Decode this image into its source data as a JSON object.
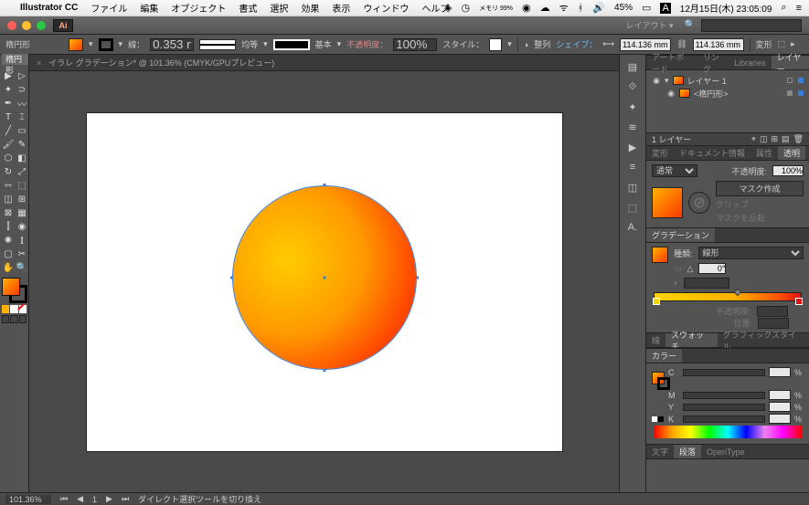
{
  "menubar": {
    "app": "Illustrator CC",
    "items": [
      "ファイル",
      "編集",
      "オブジェクト",
      "書式",
      "選択",
      "効果",
      "表示",
      "ウィンドウ",
      "ヘルプ"
    ],
    "battery": "45%",
    "date": "12月15日(木) 23:05:09",
    "mem": "メモリ 99%"
  },
  "titlebar": {
    "layout_label": "レイアウト ▾"
  },
  "optionbar": {
    "shape_label": "楕円形",
    "stroke_label": "線：",
    "stroke_width": "0.353 m",
    "uniform": "均等",
    "basic": "基本",
    "opacity_label": "不透明度：",
    "opacity_value": "100%",
    "style_label": "スタイル：",
    "align_label": "整列",
    "shape_word": "シェイプ：",
    "w_value": "114.136 mm",
    "h_value": "114.136 mm",
    "transform": "変形"
  },
  "doc": {
    "tab_title": "イラレ  グラデーション* @ 101.36% (CMYK/GPUプレビュー)",
    "zoom": "101.36%",
    "status_tool": "ダイレクト選択ツールを切り換え"
  },
  "layers_panel": {
    "tabs": [
      "アートボード",
      "リンク",
      "Libraries",
      "レイヤー"
    ],
    "layer1": "レイヤー 1",
    "shape": "<楕円形>",
    "footer": "1 レイヤー"
  },
  "appearance_panel": {
    "tabs": [
      "変形",
      "ドキュメント情報",
      "属性",
      "透明"
    ],
    "mode": "通常",
    "opacity_lbl": "不透明度:",
    "opacity_val": "100%",
    "mask_btn": "マスク作成",
    "clip": "クリップ",
    "invert": "マスクを反転"
  },
  "gradient_panel": {
    "tab": "グラデーション",
    "type_label": "種類:",
    "type_value": "線形",
    "angle_label": "△",
    "angle_value": "0°",
    "opacity_lbl": "不透明度:",
    "position_lbl": "位置:"
  },
  "stroke_panel": {
    "tabs": [
      "線",
      "スウォッチ",
      "グラフィックスタイル"
    ],
    "color_tab": "カラー",
    "channels": {
      "c": "C",
      "m": "M",
      "y": "Y",
      "k": "K"
    },
    "pct": "%"
  },
  "type_panel": {
    "tabs": [
      "文字",
      "段落",
      "OpenType"
    ]
  },
  "tooltips": {
    "tools": [
      "選択",
      "ダイレクト選択",
      "グループ",
      "なげなわ",
      "ペン",
      "曲線",
      "文字",
      "タッチ文字",
      "直線",
      "四角形",
      "ブラシ",
      "鉛筆",
      "消しゴム",
      "回転",
      "リフレクト",
      "スケール",
      "幅",
      "グラデーション",
      "スポイト",
      "ブレンド",
      "シンボル",
      "グラフ",
      "アートボード",
      "スライス",
      "手",
      "ズーム"
    ]
  }
}
